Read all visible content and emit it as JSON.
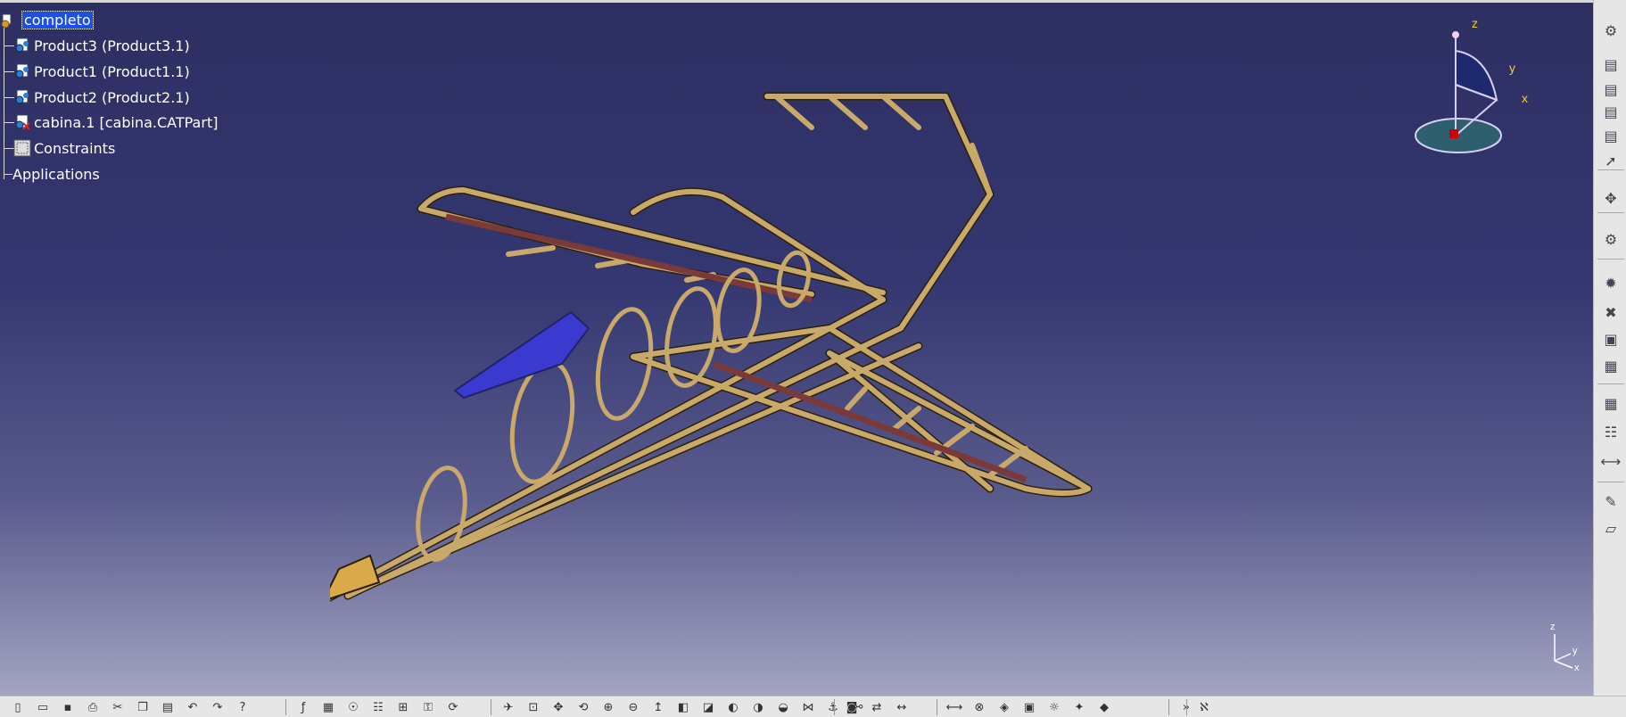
{
  "tree": {
    "root": "completo",
    "items": [
      {
        "label": "Product3 (Product3.1)",
        "icon": "product-icon"
      },
      {
        "label": "Product1 (Product1.1)",
        "icon": "product-icon"
      },
      {
        "label": "Product2 (Product2.1)",
        "icon": "product-icon"
      },
      {
        "label": "cabina.1 [cabina.CATPart]",
        "icon": "part-icon"
      },
      {
        "label": "Constraints",
        "icon": "constraints-icon"
      }
    ],
    "applications": "Applications"
  },
  "compass": {
    "z": "z",
    "y": "y",
    "x": "x"
  },
  "mini_axis": {
    "z": "z",
    "y": "y",
    "x": "x"
  },
  "colors": {
    "frame": "#c9a96a",
    "frame_edge": "#3a2e14",
    "spar": "#7a3a3a",
    "canopy": "#3a3ad0",
    "background_top": "#2d2f62",
    "background_bottom": "#a3a4c2"
  },
  "right_toolbar": [
    "gear-icon",
    "sheet-icon",
    "sheet-icon",
    "sheet-icon",
    "sheet-icon",
    "select-arrow-icon",
    "snap-icon",
    "assembly-icon",
    "explode-icon",
    "clash-icon",
    "scene-icon",
    "catalog-icon",
    "catalog-icon",
    "table-icon",
    "measure-icon",
    "annotation-icon",
    "plane-icon"
  ],
  "bottom_toolbar": [
    "new-icon",
    "open-icon",
    "save-icon",
    "print-icon",
    "cut-icon",
    "copy-icon",
    "paste-icon",
    "undo-icon",
    "redo-icon",
    "whats-this-icon",
    "formula-icon",
    "catalog-icon",
    "knowledge-icon",
    "table-icon",
    "tree-icon",
    "lock-icon",
    "update-icon",
    "fly-icon",
    "fit-all-icon",
    "pan-icon",
    "rotate-icon",
    "zoom-in-icon",
    "zoom-out-icon",
    "normal-view-icon",
    "cube-icon",
    "shading-icon",
    "hide-icon",
    "swap-icon",
    "show-icon",
    "constraint-icon",
    "fix-icon",
    "fix-together-icon",
    "camera-icon",
    "manipulate-icon",
    "distance-icon",
    "measure-icon",
    "inertia-icon",
    "render-icon",
    "scene-icon",
    "light-icon",
    "sparkle-icon",
    "render2-icon",
    "chevron-icon",
    "catia-logo-icon"
  ]
}
